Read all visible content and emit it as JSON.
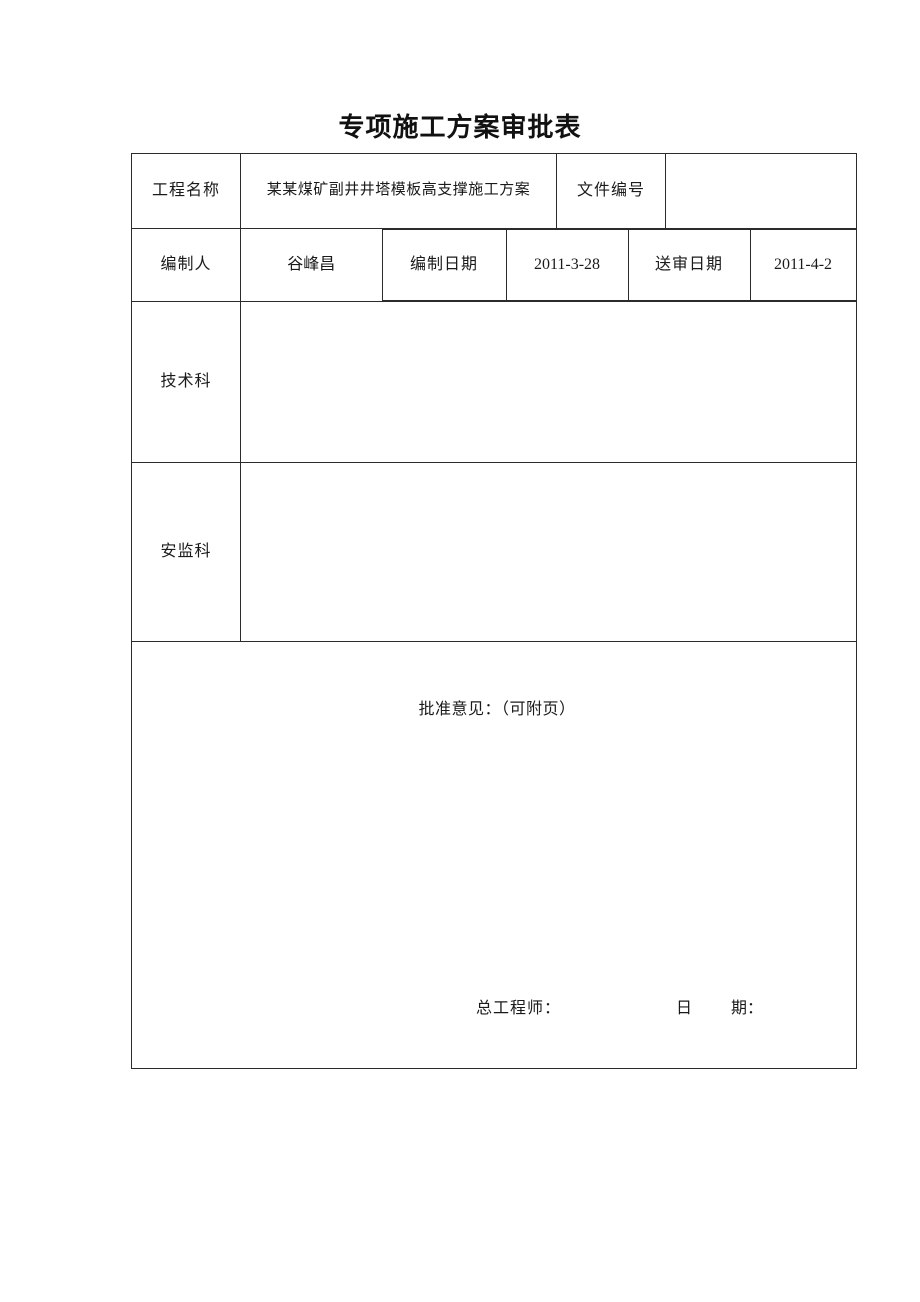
{
  "document": {
    "title": "专项施工方案审批表"
  },
  "table": {
    "row_project": {
      "label_project_name": "工程名称",
      "value_project_name": "某某煤矿副井井塔模板高支撑施工方案",
      "label_doc_number": "文件编号",
      "value_doc_number": ""
    },
    "row_author": {
      "label_author": "编制人",
      "value_author": "谷峰昌",
      "label_compile_date": "编制日期",
      "value_compile_date": "2011-3-28",
      "label_submit_date": "送审日期",
      "value_submit_date": "2011-4-2"
    },
    "row_tech_dept": {
      "label": "技术科",
      "content": ""
    },
    "row_safety_dept": {
      "label": "安监科",
      "content": ""
    },
    "row_approval": {
      "heading": "批准意见：（可附页）",
      "content": "",
      "sign_chief_engineer": "总工程师：",
      "sign_date_char_1": "日",
      "sign_date_char_2": "期："
    }
  }
}
